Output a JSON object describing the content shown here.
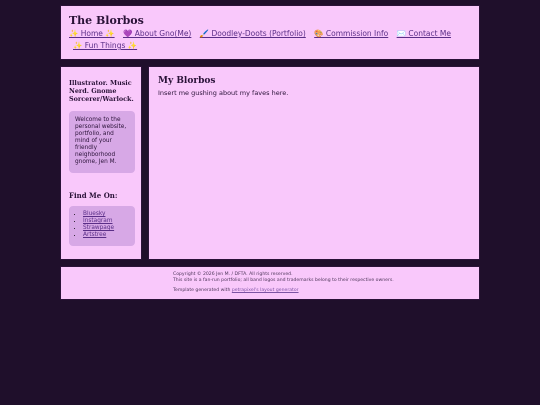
{
  "header": {
    "title": "The Blorbos",
    "nav": [
      {
        "label": "✨ Home ✨"
      },
      {
        "label": "💜 About Gno(Me)"
      },
      {
        "label": "🖌️ Doodley-Doots (Portfolio)"
      },
      {
        "label": "🎨 Commission Info"
      },
      {
        "label": "✉️ Contact Me"
      },
      {
        "label": "✨ Fun Things ✨"
      }
    ]
  },
  "sidebar": {
    "tagline": "Illustrator. Music Nerd. Gnome Sorcerer/Warlock.",
    "welcome": "Welcome to the personal website, portfolio, and mind of your friendly neighborhood gnome, Jen M.",
    "find_me_title": "Find Me On:",
    "links": [
      "Bluesky",
      "Instagram",
      "Strawpage",
      "Artstree"
    ]
  },
  "main": {
    "title": "My Blorbos",
    "body": "Insert me gushing about my faves here."
  },
  "footer": {
    "copyright": "Copyright © 2026 Jen M. / DFTA. All rights reserved.",
    "notice": "This site is a fan-run portfolio; all band logos and trademarks belong to their respective owners.",
    "generated_prefix": "Template generated with ",
    "generated_link": "petrapixel's layout generator"
  },
  "colors": {
    "page_background": "#1f0f2b",
    "panel": "#f9c8fb",
    "card": "#d7a8e6",
    "link": "#5a2e87"
  }
}
